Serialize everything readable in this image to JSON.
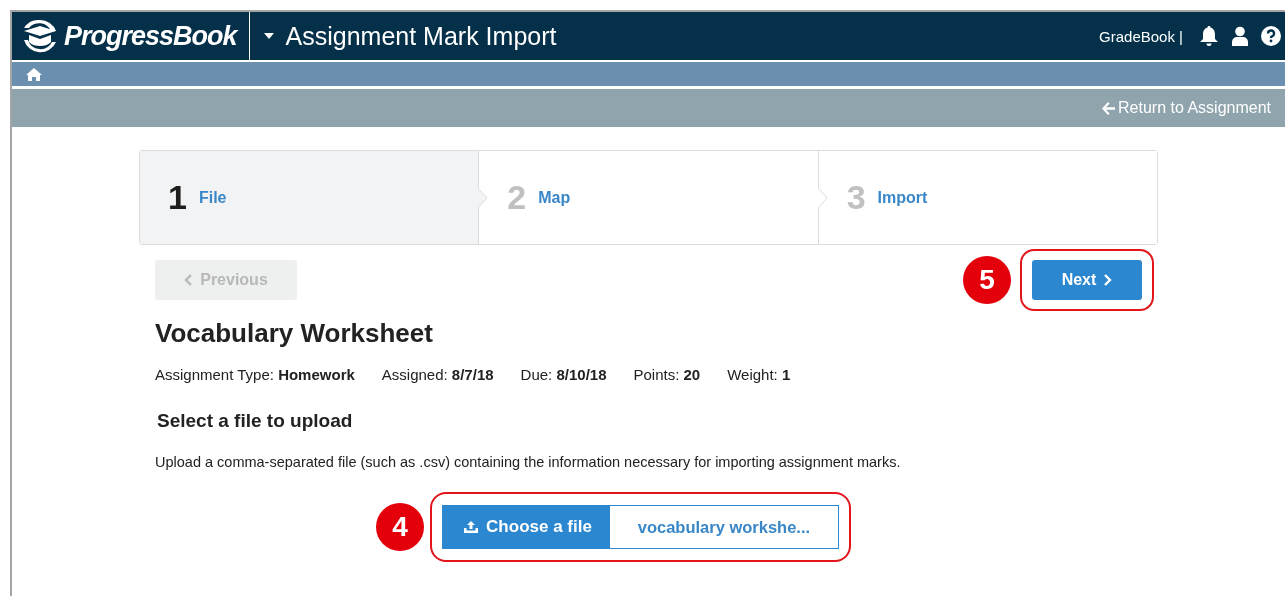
{
  "header": {
    "logo": "ProgressBook",
    "title": "Assignment Mark Import",
    "app_label": "GradeBook |"
  },
  "action_bar": {
    "return_link": "Return to Assignment"
  },
  "steps": [
    {
      "number": "1",
      "label": "File",
      "selected": true
    },
    {
      "number": "2",
      "label": "Map",
      "selected": false
    },
    {
      "number": "3",
      "label": "Import",
      "selected": false
    }
  ],
  "buttons": {
    "previous": {
      "label": "Previous",
      "disabled": true
    },
    "next": {
      "label": "Next",
      "disabled": false,
      "callout": "5"
    }
  },
  "assignment": {
    "title": "Vocabulary Worksheet",
    "meta": [
      {
        "label": "Assignment Type:",
        "value": "Homework"
      },
      {
        "label": "Assigned:",
        "value": "8/7/18"
      },
      {
        "label": "Due:",
        "value": "8/10/18"
      },
      {
        "label": "Points:",
        "value": "20"
      },
      {
        "label": "Weight:",
        "value": "1"
      }
    ]
  },
  "upload": {
    "heading": "Select a file to upload",
    "description": "Upload a comma-separated file (such as .csv) containing the information necessary for importing assignment marks.",
    "button": "Choose a file",
    "file_name": "vocabulary workshe...",
    "callout": "4"
  }
}
